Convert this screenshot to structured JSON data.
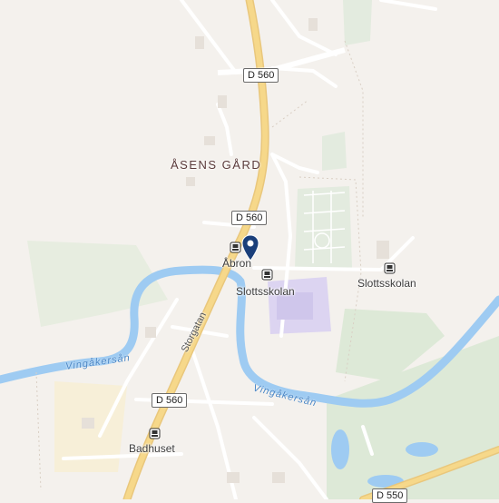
{
  "map": {
    "district": "ÅSENS GÅRD",
    "roads": {
      "top": "D 560",
      "middle": "D 560",
      "lower": "D 560",
      "bottom": "D 550"
    },
    "street": "Storgatan",
    "rivers": {
      "west": "Vingåkersån",
      "east": "Vingåkersån"
    },
    "stops": {
      "abron": "Åbron",
      "slottsskolan_a": "Slottsskolan",
      "slottsskolan_b": "Slottsskolan",
      "badhuset": "Badhuset"
    },
    "icons": {
      "bus": "bus-stop-icon",
      "pin": "location-pin-icon"
    },
    "colors": {
      "background": "#f4f1ed",
      "park": "#dde9d7",
      "water": "#9ecbf2",
      "school": "#d9d2f0",
      "highway": "#f6d88a",
      "pin": "#1a3f7a"
    }
  }
}
